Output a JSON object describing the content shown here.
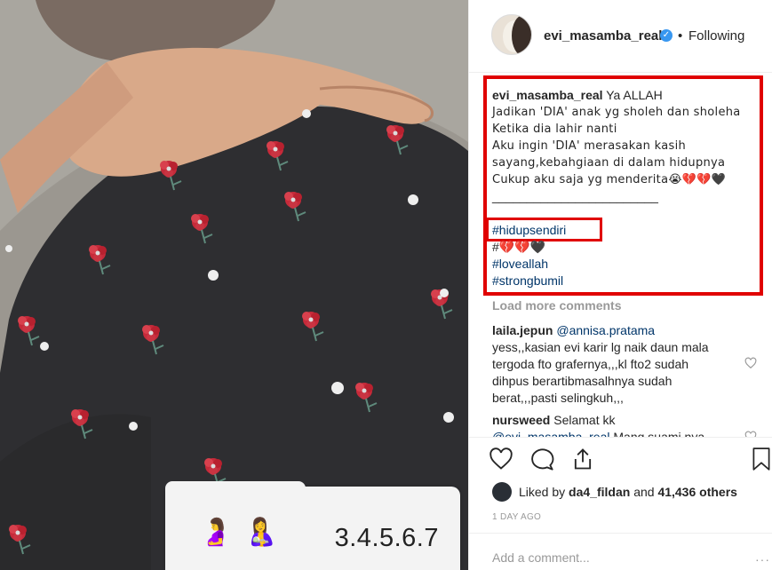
{
  "header": {
    "username": "evi_masamba_real",
    "separator": "•",
    "follow_status": "Following",
    "verified_glyph": "✓"
  },
  "overlay": {
    "emoji_1": "🤰",
    "emoji_2": "🤱",
    "number": "3.4.5.6.7"
  },
  "caption": {
    "username": "evi_masamba_real",
    "lines": [
      "Ya ALLAH",
      "Jadikan 'DIA' anak yg sholeh dan sholeha",
      "Ketika dia lahir nanti",
      "Aku ingin 'DIA' merasakan kasih",
      "sayang,kebahgiaan di dalam hidupnya",
      "Cukup aku saja yg menderita😭💔💔🖤",
      "________________________"
    ],
    "tags": [
      "#hidupsendiri",
      "#💔💔🖤",
      "#loveallah",
      "#strongbumil"
    ]
  },
  "load_more": "Load more comments",
  "comments": [
    {
      "user": "laila.jepun",
      "mention": "@annisa.pratama",
      "text_lines": [
        "yess,,kasian evi karir lg naik daun mala",
        "tergoda fto grafernya,,,kl fto2 sudah",
        "dihpus berartibmasalhnya sudah",
        "berat,,,pasti selingkuh,,,"
      ]
    },
    {
      "user": "nursweed",
      "first": "Selamat kk",
      "mention": "@evi_masamba_real",
      "rest": "Mang suami nya"
    }
  ],
  "likes": {
    "prefix": "Liked by",
    "user": "da4_fildan",
    "and": "and",
    "count": "41,436 others"
  },
  "timestamp": "1 DAY AGO",
  "add_comment_placeholder": "Add a comment...",
  "more_glyph": "···",
  "colors": {
    "highlight_red": "#e00000",
    "link_blue": "#003569",
    "verified_blue": "#3897f0"
  }
}
